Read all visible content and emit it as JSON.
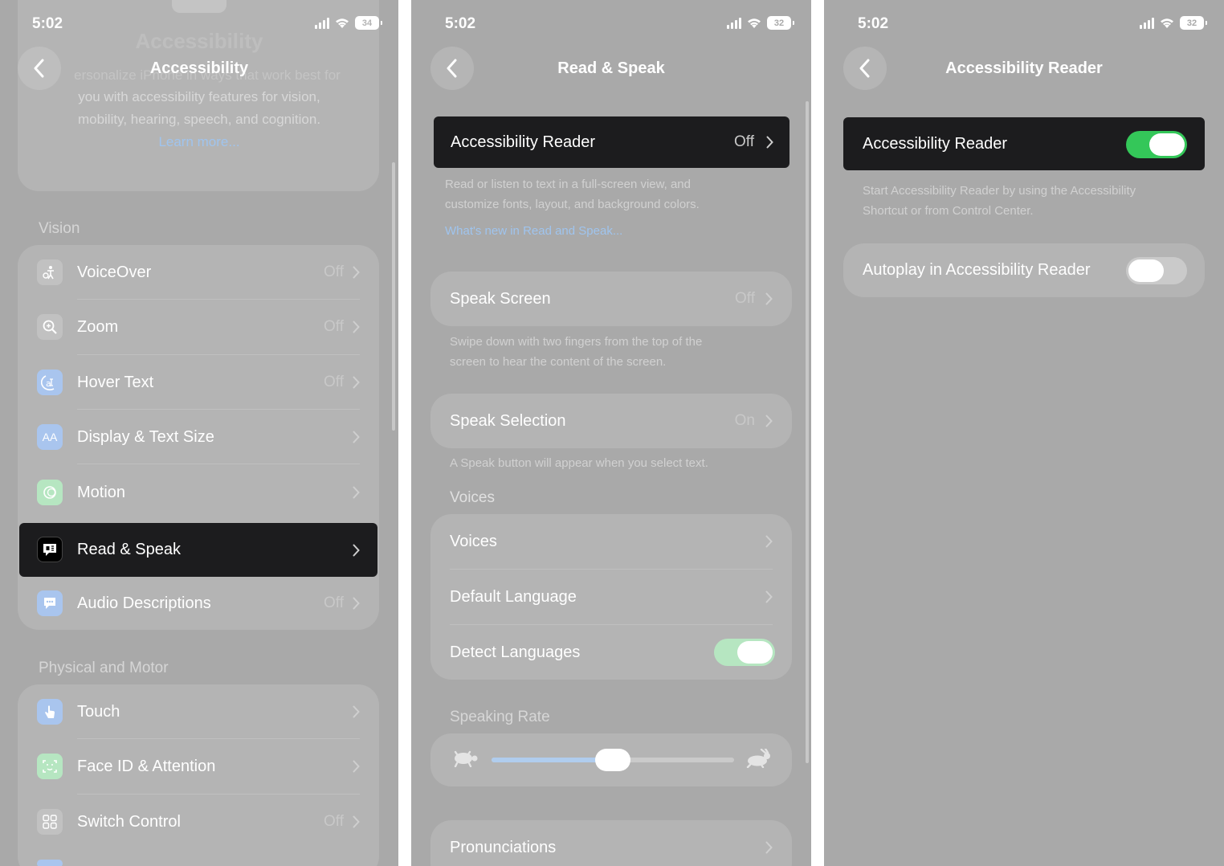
{
  "screen1": {
    "time": "5:02",
    "battery": "34",
    "title": "Accessibility",
    "ghost_title": "Accessibility",
    "intro_fragment": "ersonalize iPhone in ways that work best for",
    "intro_line2": "you with accessibility features for vision,",
    "intro_line3": "mobility, hearing, speech, and cognition.",
    "learn_more": "Learn more...",
    "vision_header": "Vision",
    "vision_items": [
      {
        "label": "VoiceOver",
        "value": "Off",
        "icon": "voiceover-icon"
      },
      {
        "label": "Zoom",
        "value": "Off",
        "icon": "zoom-icon"
      },
      {
        "label": "Hover Text",
        "value": "Off",
        "icon": "hover-text-icon"
      },
      {
        "label": "Display & Text Size",
        "value": "",
        "icon": "text-size-icon"
      },
      {
        "label": "Motion",
        "value": "",
        "icon": "motion-icon"
      },
      {
        "label": "Read & Speak",
        "value": "",
        "icon": "read-speak-icon"
      },
      {
        "label": "Audio Descriptions",
        "value": "Off",
        "icon": "audio-descriptions-icon"
      }
    ],
    "physical_header": "Physical and Motor",
    "physical_items": [
      {
        "label": "Touch",
        "value": "",
        "icon": "touch-icon"
      },
      {
        "label": "Face ID & Attention",
        "value": "",
        "icon": "face-id-icon"
      },
      {
        "label": "Switch Control",
        "value": "Off",
        "icon": "switch-control-icon"
      }
    ]
  },
  "screen2": {
    "time": "5:02",
    "battery": "32",
    "title": "Read & Speak",
    "reader_label": "Accessibility Reader",
    "reader_value": "Off",
    "reader_footer_line1": "Read or listen to text in a full-screen view, and",
    "reader_footer_line2": "customize fonts, layout, and background colors.",
    "whats_new": "What's new in Read and Speak...",
    "speak_screen_label": "Speak Screen",
    "speak_screen_value": "Off",
    "speak_screen_footer_line1": "Swipe down with two fingers from the top of the",
    "speak_screen_footer_line2": "screen to hear the content of the screen.",
    "speak_selection_label": "Speak Selection",
    "speak_selection_value": "On",
    "speak_selection_footer": "A Speak button will appear when you select text.",
    "voices_header": "Voices",
    "voices_label": "Voices",
    "default_language_label": "Default Language",
    "detect_languages_label": "Detect Languages",
    "detect_languages_on": true,
    "speaking_rate_header": "Speaking Rate",
    "speaking_rate_fraction": 0.5,
    "pronunciations_label": "Pronunciations"
  },
  "screen3": {
    "time": "5:02",
    "battery": "32",
    "title": "Accessibility Reader",
    "reader_toggle_label": "Accessibility Reader",
    "reader_toggle_on": true,
    "footer_line1": "Start Accessibility Reader by using the Accessibility",
    "footer_line2": "Shortcut or from Control Center.",
    "autoplay_label": "Autoplay in Accessibility Reader",
    "autoplay_on": false
  },
  "colors": {
    "dimmed_background": "#a9a9a9",
    "highlight": "#1c1c1e",
    "toggle_green": "#34c759",
    "toggle_green_dim": "#b6e6c1",
    "link_blue": "#9fc4ee"
  }
}
